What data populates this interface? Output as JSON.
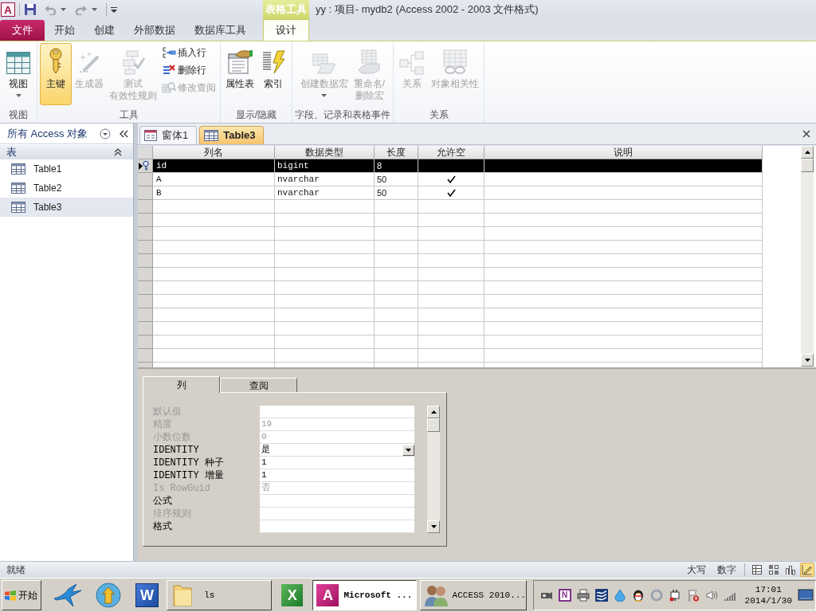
{
  "quick_access": {
    "app_letter": "A"
  },
  "title_bar": {
    "contextual_group": "表格工具",
    "title": "yy : 项目- mydb2 (Access 2002 - 2003 文件格式)"
  },
  "ribbon_tabs": [
    {
      "label": "文件",
      "kind": "file",
      "selected": false
    },
    {
      "label": "开始",
      "kind": "normal",
      "selected": false
    },
    {
      "label": "创建",
      "kind": "normal",
      "selected": false
    },
    {
      "label": "外部数据",
      "kind": "normal",
      "selected": false
    },
    {
      "label": "数据库工具",
      "kind": "normal",
      "selected": false
    },
    {
      "label": "设计",
      "kind": "contextual",
      "selected": true
    }
  ],
  "ribbon": {
    "groups": [
      {
        "buttons": [
          {
            "label": [
              "视图"
            ],
            "kind": "large",
            "dropdown": true,
            "active": false,
            "disabled": false
          }
        ],
        "label": "视图"
      },
      {
        "buttons": [
          {
            "label": [
              "主键"
            ],
            "kind": "large",
            "dropdown": false,
            "active": true,
            "disabled": false
          },
          {
            "label": [
              "生成器"
            ],
            "kind": "large",
            "dropdown": false,
            "active": false,
            "disabled": true
          },
          {
            "label": [
              "测试",
              "有效性规则"
            ],
            "kind": "large",
            "dropdown": false,
            "active": false,
            "disabled": true
          },
          {
            "label": [
              "插入行"
            ],
            "kind": "small",
            "dropdown": false,
            "active": false,
            "disabled": false
          },
          {
            "label": [
              "删除行"
            ],
            "kind": "small",
            "dropdown": false,
            "active": false,
            "disabled": false
          },
          {
            "label": [
              "修改查阅"
            ],
            "kind": "small",
            "dropdown": false,
            "active": false,
            "disabled": true
          }
        ],
        "label": "工具"
      },
      {
        "buttons": [
          {
            "label": [
              "属性表"
            ],
            "kind": "large",
            "dropdown": false,
            "active": false,
            "disabled": false
          },
          {
            "label": [
              "索引"
            ],
            "kind": "large",
            "dropdown": false,
            "active": false,
            "disabled": false
          }
        ],
        "label": "显示/隐藏"
      },
      {
        "buttons": [
          {
            "label": [
              "创建数据宏"
            ],
            "kind": "large",
            "dropdown": true,
            "active": false,
            "disabled": true
          },
          {
            "label": [
              "重命名/",
              "删除宏"
            ],
            "kind": "large",
            "dropdown": false,
            "active": false,
            "disabled": true
          }
        ],
        "label": "字段、记录和表格事件"
      },
      {
        "buttons": [
          {
            "label": [
              "关系"
            ],
            "kind": "large",
            "dropdown": false,
            "active": false,
            "disabled": true
          },
          {
            "label": [
              "对象相关性"
            ],
            "kind": "large",
            "dropdown": false,
            "active": false,
            "disabled": true
          }
        ],
        "label": "关系"
      }
    ]
  },
  "navigation_pane": {
    "title": "所有 Access 对象",
    "groups": [
      {
        "label": "表",
        "expanded": true,
        "items": [
          {
            "label": "Table1",
            "selected": false
          },
          {
            "label": "Table2",
            "selected": false
          },
          {
            "label": "Table3",
            "selected": true
          }
        ]
      }
    ]
  },
  "document_tabs": [
    {
      "label": "窗体1",
      "kind": "form",
      "selected": false
    },
    {
      "label": "Table3",
      "kind": "table",
      "selected": true
    }
  ],
  "table_design": {
    "columns": [
      "列名",
      "数据类型",
      "长度",
      "允许空",
      "说明"
    ],
    "rows": [
      {
        "column_name": "id",
        "data_type": "bigint",
        "length": "8",
        "allow_null": false,
        "primary_key": true,
        "selected": true
      },
      {
        "column_name": "A",
        "data_type": "nvarchar",
        "length": "50",
        "allow_null": true,
        "primary_key": false,
        "selected": false
      },
      {
        "column_name": "B",
        "data_type": "nvarchar",
        "length": "50",
        "allow_null": true,
        "primary_key": false,
        "selected": false
      }
    ]
  },
  "property_sheet": {
    "tabs": [
      {
        "label": "列",
        "selected": true
      },
      {
        "label": "查阅",
        "selected": false
      }
    ],
    "properties": [
      {
        "label": "默认值",
        "kind": "text",
        "disabled": true
      },
      {
        "label": "精度",
        "value": "19",
        "kind": "text",
        "disabled": true
      },
      {
        "label": "小数位数",
        "value": "0",
        "kind": "text",
        "disabled": true
      },
      {
        "label": "IDENTITY",
        "value": "是",
        "kind": "dropdown",
        "disabled": false
      },
      {
        "label": "IDENTITY 种子",
        "value": "1",
        "kind": "text",
        "disabled": false
      },
      {
        "label": "IDENTITY 增量",
        "value": "1",
        "kind": "text",
        "disabled": false
      },
      {
        "label": "Is RowGuid",
        "value": "否",
        "kind": "text",
        "disabled": true
      },
      {
        "label": "公式",
        "kind": "text",
        "disabled": false
      },
      {
        "label": "排序规则",
        "kind": "text",
        "disabled": true
      },
      {
        "label": "格式",
        "kind": "text",
        "disabled": false
      }
    ]
  },
  "status_bar": {
    "text": "就绪",
    "indicators": [
      "大写",
      "数字"
    ],
    "view_buttons": [
      {
        "selected": false
      },
      {
        "selected": false
      },
      {
        "selected": false
      },
      {
        "selected": true
      }
    ]
  },
  "taskbar": {
    "start": "开始",
    "launcher_letter": "W",
    "tasks": [
      {
        "kind": "folder",
        "label": "ls",
        "selected": false
      },
      {
        "kind": "sheet",
        "letter": "X",
        "selected": false
      },
      {
        "kind": "app",
        "letter": "A",
        "label": "Microsoft ...",
        "selected": true
      },
      {
        "kind": "people",
        "label": "ACCESS 2010...",
        "selected": false
      }
    ],
    "tray_letter": "N",
    "clock": {
      "time": "17:01",
      "date": "2014/1/30"
    }
  }
}
